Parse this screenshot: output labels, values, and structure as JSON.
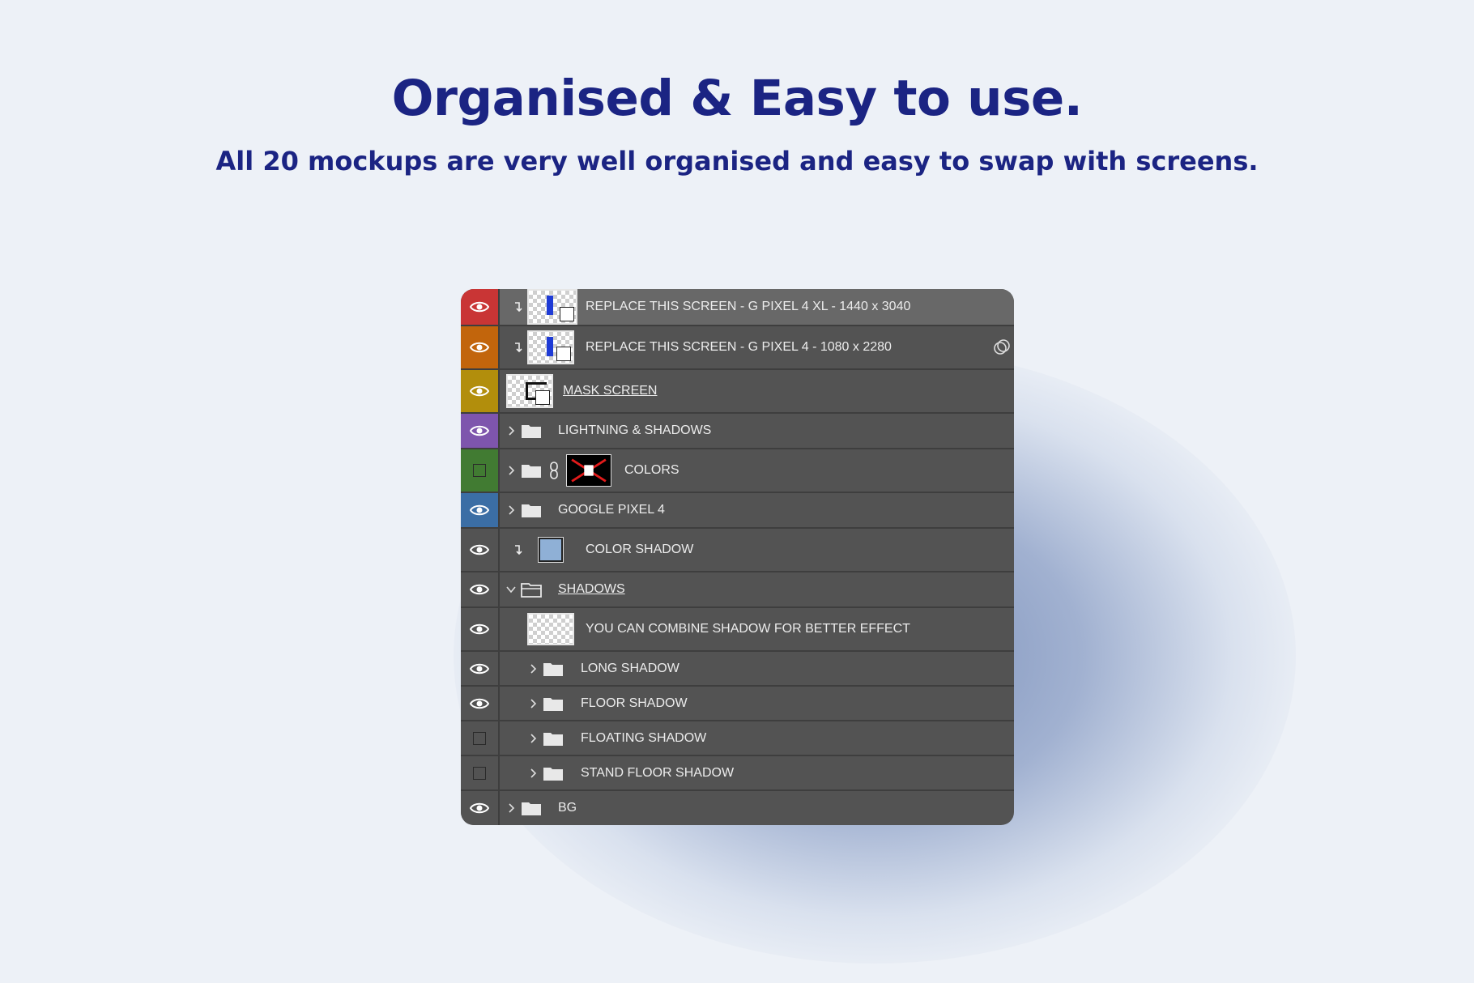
{
  "header": {
    "title": "Organised & Easy to use.",
    "subtitle": "All 20 mockups are very well organised and easy to swap with screens."
  },
  "layers": [
    {
      "label": "REPLACE THIS SCREEN - G PIXEL 4 XL - 1440 x 3040",
      "visible": true,
      "tag_color": "#c93535"
    },
    {
      "label": "REPLACE THIS SCREEN - G PIXEL 4 - 1080 x 2280",
      "visible": true,
      "tag_color": "#c2650c"
    },
    {
      "label": "MASK SCREEN",
      "visible": true,
      "tag_color": "#b28e0c"
    },
    {
      "label": "LIGHTNING & SHADOWS",
      "visible": true,
      "tag_color": "#7e55ad"
    },
    {
      "label": "COLORS",
      "visible": false,
      "tag_color": "#417b32"
    },
    {
      "label": "GOOGLE PIXEL 4",
      "visible": true,
      "tag_color": "#3b6ea5"
    },
    {
      "label": "COLOR SHADOW",
      "visible": true
    },
    {
      "label": "SHADOWS",
      "visible": true
    },
    {
      "label": "YOU CAN COMBINE SHADOW FOR BETTER EFFECT",
      "visible": true
    },
    {
      "label": "LONG SHADOW",
      "visible": true
    },
    {
      "label": "FLOOR SHADOW",
      "visible": true
    },
    {
      "label": "FLOATING SHADOW",
      "visible": false
    },
    {
      "label": "STAND FLOOR SHADOW",
      "visible": false
    },
    {
      "label": "BG",
      "visible": true
    }
  ],
  "icons": {
    "visibility": "eye-icon",
    "hidden": "empty-box-icon",
    "group": "folder-icon",
    "expand": "chevron-right-icon",
    "collapse": "chevron-down-icon",
    "clipping": "clipping-mask-arrow-icon",
    "link": "chain-link-icon",
    "smart_object": "smart-object-icon"
  },
  "colors": {
    "title": "#1b2483",
    "panel_bg": "#535353",
    "selected_row": "#686868",
    "color_shadow_swatch": "#8fb0d6"
  }
}
